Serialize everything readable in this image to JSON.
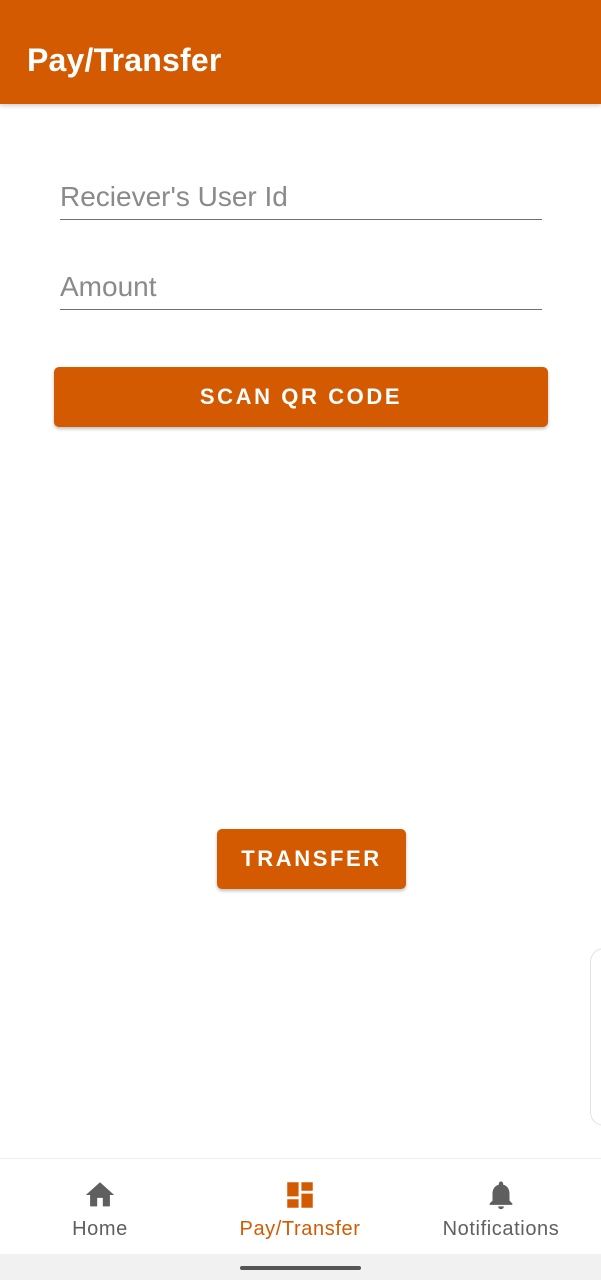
{
  "appbar": {
    "title": "Pay/Transfer"
  },
  "form": {
    "receiver": {
      "placeholder": "Reciever's User Id",
      "value": ""
    },
    "amount": {
      "placeholder": "Amount",
      "value": ""
    },
    "scan_label": "SCAN QR CODE",
    "transfer_label": "TRANSFER"
  },
  "bottom_nav": {
    "items": [
      {
        "label": "Home",
        "icon": "home-icon",
        "active": false
      },
      {
        "label": "Pay/Transfer",
        "icon": "dashboard-icon",
        "active": true
      },
      {
        "label": "Notifications",
        "icon": "bell-icon",
        "active": false
      }
    ]
  },
  "colors": {
    "accent": "#D35A00",
    "inactive": "#5f5f5f",
    "placeholder": "#8a8a8a"
  }
}
